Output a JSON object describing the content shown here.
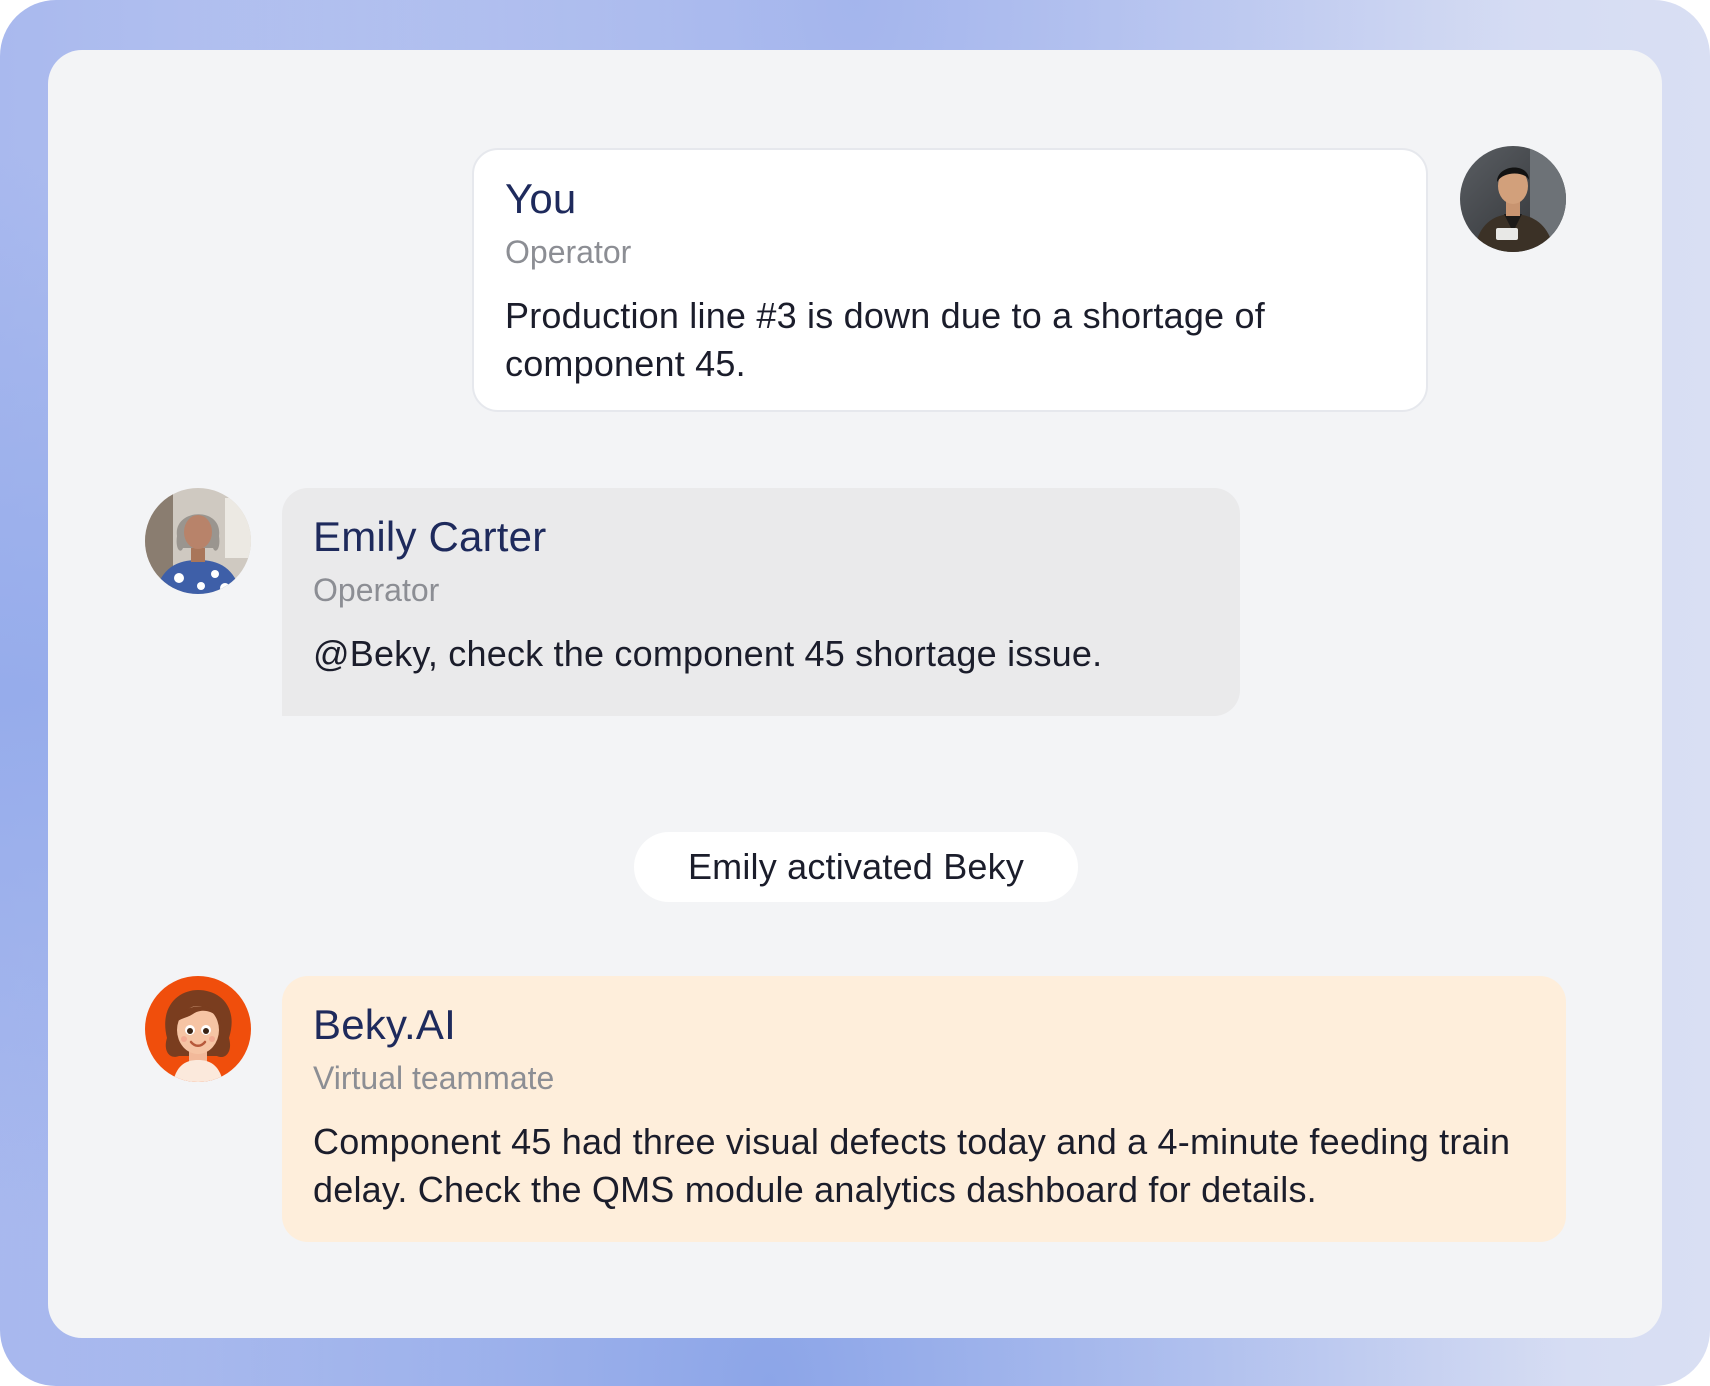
{
  "messages": [
    {
      "sender": "You",
      "role": "Operator",
      "text": "Production line #3 is down due to a shortage of component 45.",
      "avatar": "person-avatar-man"
    },
    {
      "sender": "Emily Carter",
      "role": "Operator",
      "text": "@Beky, check the component 45 shortage issue.",
      "avatar": "person-avatar-woman"
    },
    {
      "sender": "Beky.AI",
      "role": "Virtual teammate",
      "text": "Component 45 had three visual defects today and a 4-minute feeding train delay. Check the QMS module analytics dashboard for details.",
      "avatar": "ai-avatar-cartoon"
    }
  ],
  "system_event": "Emily activated Beky",
  "colors": {
    "name_text": "#1e2a5c",
    "role_text": "#8c8e94",
    "you_bubble": "#ffffff",
    "emily_bubble": "#eaeaeb",
    "beky_bubble": "#feeedb",
    "beky_avatar_bg": "#f04e0c",
    "panel_bg": "#f3f4f6"
  }
}
